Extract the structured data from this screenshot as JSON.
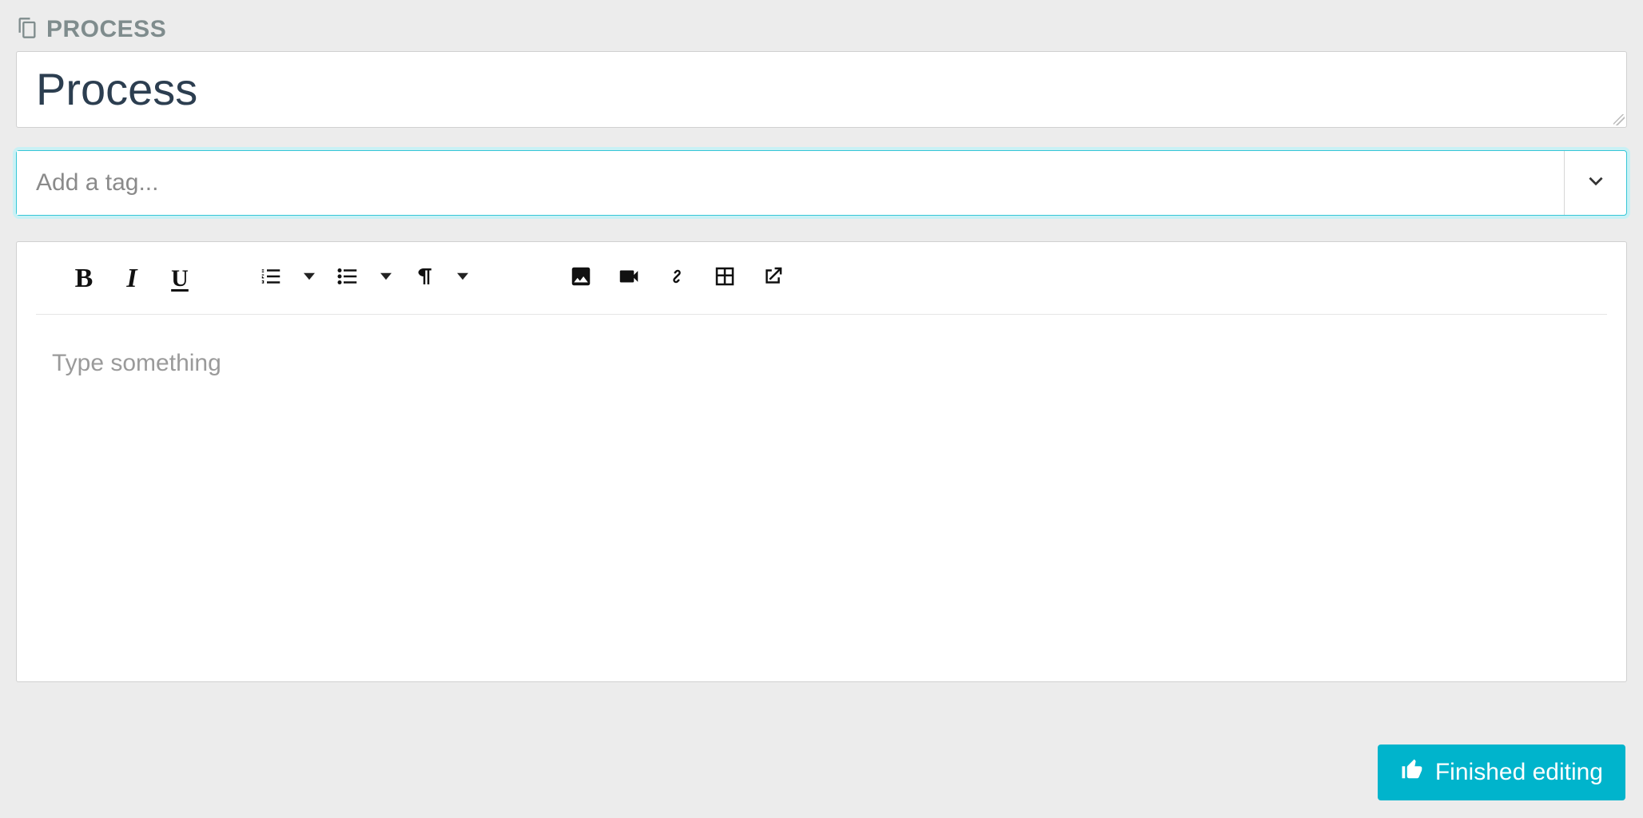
{
  "header": {
    "label": "PROCESS"
  },
  "title_field": {
    "value": "Process"
  },
  "tag_field": {
    "placeholder": "Add a tag..."
  },
  "editor": {
    "placeholder": "Type something"
  },
  "actions": {
    "finished_label": "Finished editing"
  },
  "toolbar": {
    "bold": "B",
    "italic": "I",
    "underline": "U"
  }
}
